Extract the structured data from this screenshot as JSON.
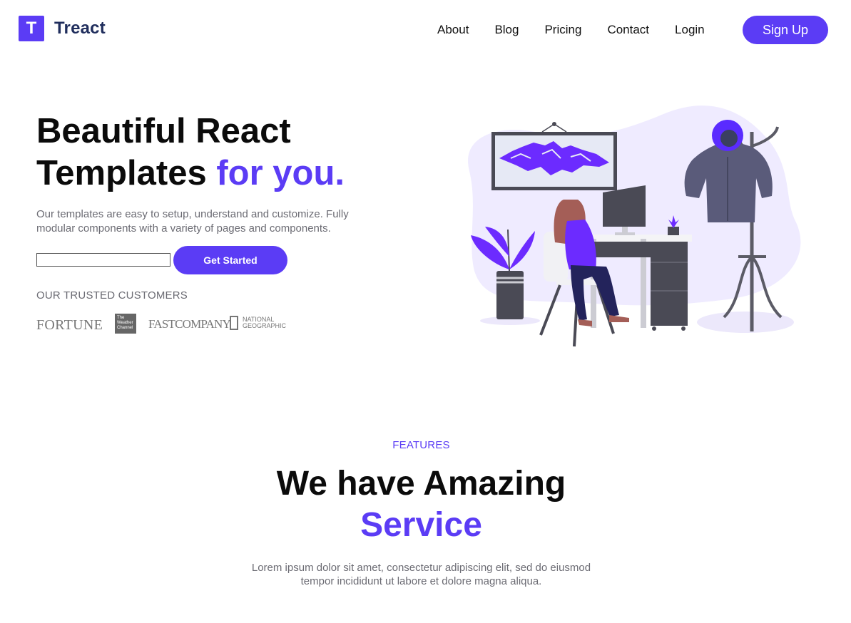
{
  "header": {
    "logo_letter": "T",
    "brand": "Treact",
    "nav": [
      "About",
      "Blog",
      "Pricing",
      "Contact",
      "Login"
    ],
    "signup_label": "Sign Up"
  },
  "hero": {
    "title_line1": "Beautiful React",
    "title_line2": "Templates",
    "title_accent": "for you.",
    "description": "Our templates are easy to setup, understand and customize. Fully modular components with a variety of pages and components.",
    "input_value": "",
    "cta_label": "Get Started",
    "trusted_label": "OUR TRUSTED CUSTOMERS",
    "customer_logos": {
      "fortune": "FORTUNE",
      "weather": "The Weather Channel",
      "fastco": "FASTCOMPANY",
      "natgeo": "NATIONAL GEOGRAPHIC"
    }
  },
  "features": {
    "label": "FEATURES",
    "title": "We have Amazing",
    "title_accent": "Service",
    "description": "Lorem ipsum dolor sit amet, consectetur adipiscing elit, sed do eiusmod tempor incididunt ut labore et dolore magna aliqua."
  },
  "colors": {
    "primary": "#5b3cf5",
    "brand_text": "#1f2d5c",
    "muted_text": "#6b6b73",
    "illustration_bg": "#efebff"
  },
  "icons": [
    "logo-mark-icon",
    "hero-illustration"
  ]
}
